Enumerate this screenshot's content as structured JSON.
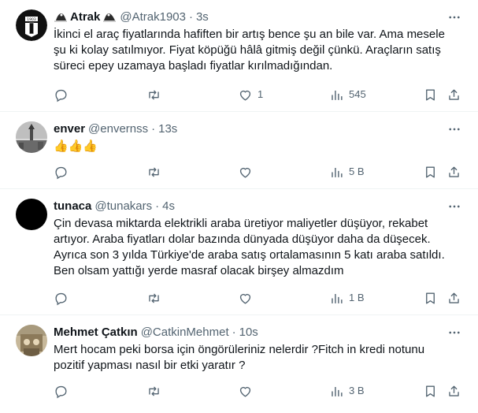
{
  "colors": {
    "text": "#0f1419",
    "secondary": "#536471",
    "divider": "#eff3f4"
  },
  "tweets": [
    {
      "name": "Atrak",
      "name_emoji": "eagle-flag-icon",
      "handle": "@Atrak1903",
      "separator": "·",
      "time": "3s",
      "avatar": "bjk-crest-avatar",
      "lines": [
        "İkinci el araç fiyatlarında hafiften bir artış bence şu an bile var. Ama mesele",
        "şu ki kolay satılmıyor. Fiyat köpüğü hâlâ gitmiş değil çünkü. Araçların satış",
        "süreci epey uzamaya başladı fiyatlar kırılmadığından."
      ],
      "replies": "",
      "retweets": "",
      "likes": "1",
      "views": "545"
    },
    {
      "name": "enver",
      "handle": "@envernss",
      "separator": "·",
      "time": "13s",
      "avatar": "tower-photo-avatar",
      "lines": [
        "👍👍👍"
      ],
      "replies": "",
      "retweets": "",
      "likes": "",
      "views": "5 B"
    },
    {
      "name": "tunaca",
      "handle": "@tunakars",
      "separator": "·",
      "time": "4s",
      "avatar": "black-avatar",
      "lines": [
        "Çin devasa miktarda elektrikli araba üretiyor maliyetler düşüyor, rekabet",
        "artıyor. Araba fiyatları dolar bazında dünyada düşüyor daha da düşecek.",
        "Ayrıca son 3 yılda Türkiye'de araba satış ortalamasının 5 katı araba satıldı.",
        "Ben olsam yattığı yerde masraf olacak birşey almazdım"
      ],
      "replies": "",
      "retweets": "",
      "likes": "",
      "views": "1 B"
    },
    {
      "name": "Mehmet Çatkın",
      "handle": "@CatkinMehmet",
      "separator": "·",
      "time": "10s",
      "avatar": "photo-avatar",
      "lines": [
        "Mert hocam peki borsa için öngörüleriniz nelerdir ?Fitch in kredi notunu",
        "pozitif yapması nasıl bir etki yaratır ?"
      ],
      "replies": "",
      "retweets": "",
      "likes": "",
      "views": "3 B"
    }
  ]
}
